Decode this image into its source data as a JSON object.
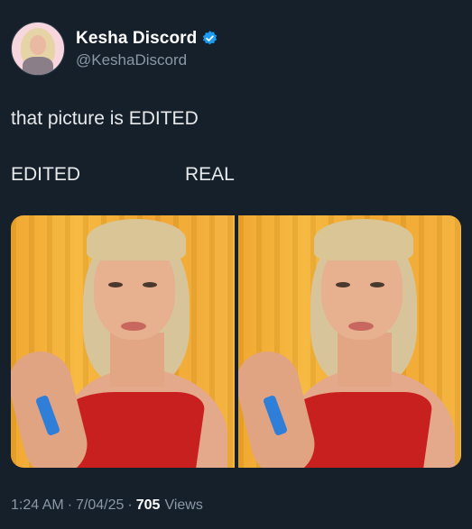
{
  "tweet": {
    "author": {
      "display_name": "Kesha Discord",
      "handle": "@KeshaDiscord",
      "verified_icon": "verified-badge-icon",
      "verified_color": "#1d9bf0"
    },
    "text": "that picture is EDITED",
    "labels": {
      "left": "EDITED",
      "right": "REAL"
    },
    "meta": {
      "time": "1:24 AM",
      "separator": "·",
      "date": "7/04/25",
      "views_count": "705",
      "views_label": "Views"
    }
  },
  "colors": {
    "background": "#15202b",
    "text": "#e7e9ea",
    "muted": "#8b98a5",
    "photo_background": "#f5ab2f",
    "dress": "#c8201f"
  }
}
